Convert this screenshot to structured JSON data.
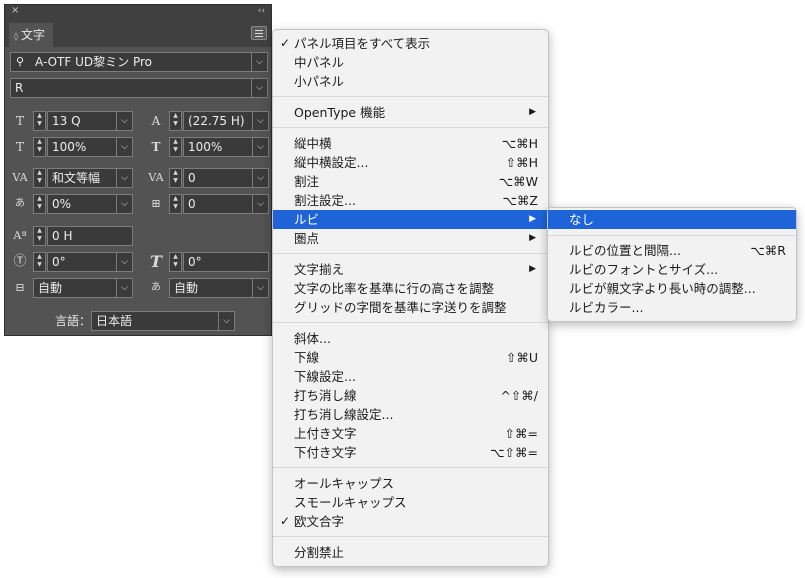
{
  "panel": {
    "close": "×",
    "collapse": "‹‹",
    "tab_arrow": "◊",
    "tab_label": "文字",
    "font_family": "A-OTF UD黎ミン Pro",
    "font_style": "R",
    "font_size": "13 Q",
    "leading": "(22.75 H)",
    "vertical_scale": "100%",
    "horizontal_scale": "100%",
    "kerning": "和文等幅",
    "tracking": "0",
    "tsume": "0%",
    "mojikumi_grid": "0",
    "baseline_shift": "0 H",
    "rotation": "0°",
    "skew": "0°",
    "aki_before": "自動",
    "aki_after": "自動",
    "language_label": "言語：",
    "language": "日本語",
    "dropdown_glyph": "⌵",
    "step_up": "▲",
    "step_down": "▼"
  },
  "main_menu": {
    "check": "✓",
    "submenu_arrow": "▶",
    "items": [
      {
        "label": "パネル項目をすべて表示",
        "checked": true
      },
      {
        "label": "中パネル"
      },
      {
        "label": "小パネル"
      },
      {
        "label": "OpenType 機能"
      },
      {
        "label": "縦中横",
        "shortcut": "⌥⌘H"
      },
      {
        "label": "縦中横設定...",
        "shortcut": "⇧⌘H"
      },
      {
        "label": "割注",
        "shortcut": "⌥⌘W"
      },
      {
        "label": "割注設定...",
        "shortcut": "⌥⌘Z"
      },
      {
        "label": "ルビ"
      },
      {
        "label": "圏点"
      },
      {
        "label": "文字揃え"
      },
      {
        "label": "文字の比率を基準に行の高さを調整"
      },
      {
        "label": "グリッドの字間を基準に字送りを調整"
      },
      {
        "label": "斜体..."
      },
      {
        "label": "下線",
        "shortcut": "⇧⌘U"
      },
      {
        "label": "下線設定..."
      },
      {
        "label": "打ち消し線",
        "shortcut": "^⇧⌘/"
      },
      {
        "label": "打ち消し線設定..."
      },
      {
        "label": "上付き文字",
        "shortcut": "⇧⌘="
      },
      {
        "label": "下付き文字",
        "shortcut": "⌥⇧⌘="
      },
      {
        "label": "オールキャップス"
      },
      {
        "label": "スモールキャップス"
      },
      {
        "label": "欧文合字",
        "checked": true
      },
      {
        "label": "分割禁止"
      }
    ]
  },
  "ruby_submenu": {
    "items": [
      {
        "label": "なし"
      },
      {
        "label": "ルビの位置と間隔...",
        "shortcut": "⌥⌘R"
      },
      {
        "label": "ルビのフォントとサイズ..."
      },
      {
        "label": "ルビが親文字より長い時の調整..."
      },
      {
        "label": "ルビカラー..."
      }
    ]
  }
}
